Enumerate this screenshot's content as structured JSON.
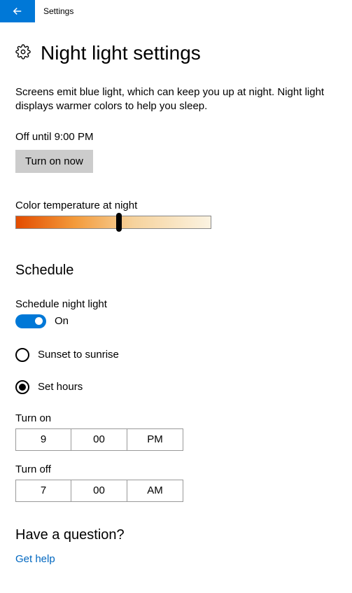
{
  "titlebar": {
    "label": "Settings"
  },
  "page_title": "Night light settings",
  "description": "Screens emit blue light, which can keep you up at night. Night light displays warmer colors to help you sleep.",
  "status": "Off until 9:00 PM",
  "turn_on_button": "Turn on now",
  "color_temp": {
    "label": "Color temperature at night",
    "value_percent": 53
  },
  "schedule": {
    "heading": "Schedule",
    "toggle_label": "Schedule night light",
    "toggle_state": "On",
    "options": {
      "sunset": "Sunset to sunrise",
      "set_hours": "Set hours"
    },
    "selected": "set_hours",
    "turn_on": {
      "label": "Turn on",
      "hour": "9",
      "minute": "00",
      "period": "PM"
    },
    "turn_off": {
      "label": "Turn off",
      "hour": "7",
      "minute": "00",
      "period": "AM"
    }
  },
  "help": {
    "heading": "Have a question?",
    "link": "Get help"
  }
}
